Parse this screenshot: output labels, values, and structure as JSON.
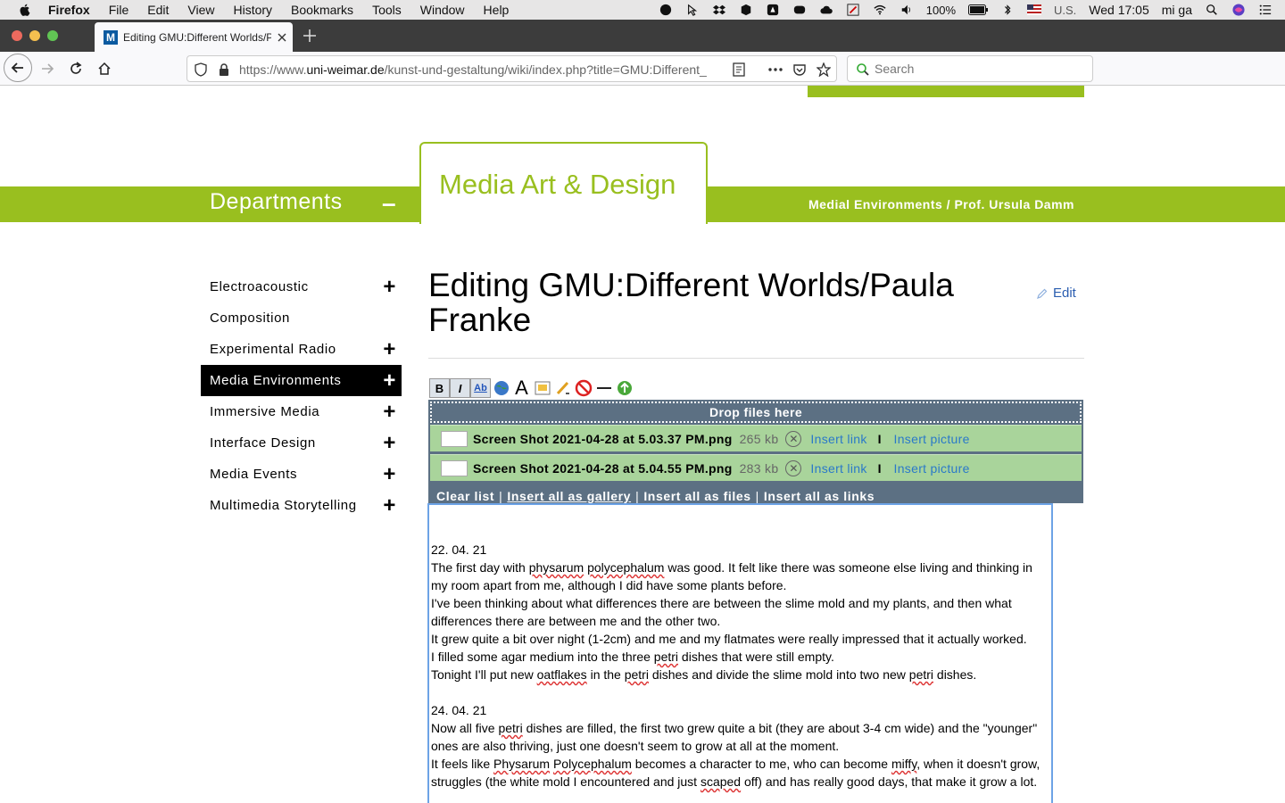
{
  "menubar": {
    "app": "Firefox",
    "items": [
      "File",
      "Edit",
      "View",
      "History",
      "Bookmarks",
      "Tools",
      "Window",
      "Help"
    ],
    "battery": "100%",
    "input_source": "U.S.",
    "clock": "Wed 17:05",
    "user": "mi ga"
  },
  "browser": {
    "tab_title": "Editing GMU:Different Worlds/P",
    "favicon_letter": "M",
    "url_prefix": "https://www.",
    "url_host": "uni-weimar.de",
    "url_path": "/kunst-und-gestaltung/wiki/index.php?title=GMU:Different_",
    "search_placeholder": "Search",
    "colors": {
      "tabstrip": "#3c3c3c",
      "toolbar": "#f9f9fb"
    }
  },
  "header": {
    "faculty": "Media Art & Design",
    "departments": "Departments",
    "collapse": "–",
    "chair": "Medial Environments / Prof. Ursula Damm",
    "accent": "#99bf1f"
  },
  "sidebar": {
    "items": [
      {
        "label": "Electroacoustic",
        "plus": "+"
      },
      {
        "label": "Composition",
        "plus": ""
      },
      {
        "label": "Experimental Radio",
        "plus": "+"
      },
      {
        "label": "Media Environments",
        "plus": "+"
      },
      {
        "label": "Immersive Media",
        "plus": "+"
      },
      {
        "label": "Interface Design",
        "plus": "+"
      },
      {
        "label": "Media Events",
        "plus": "+"
      },
      {
        "label": "Multimedia Storytelling",
        "plus": "+"
      }
    ]
  },
  "main": {
    "title": "Editing GMU:Different Worlds/Paula Franke",
    "edit_label": "Edit"
  },
  "toolbar": {
    "bold": "B",
    "italic": "I",
    "link": "Ab",
    "headline": "A"
  },
  "upload": {
    "drop_label": "Drop files here",
    "files": [
      {
        "name": "Screen Shot 2021-04-28 at 5.03.37 PM.png",
        "size": "265 kb",
        "insert_link": "Insert link",
        "sep": "I",
        "insert_picture": "Insert picture"
      },
      {
        "name": "Screen Shot 2021-04-28 at 5.04.55 PM.png",
        "size": "283 kb",
        "insert_link": "Insert link",
        "sep": "I",
        "insert_picture": "Insert picture"
      }
    ],
    "actions": {
      "clear": "Clear list",
      "gallery": "Insert all as gallery",
      "files": "Insert all as files",
      "links": "Insert all as links",
      "sep": "|"
    }
  },
  "editor": {
    "entry1": {
      "date": "22. 04. 21",
      "l1a": "The first day with ",
      "l1b": "physarum",
      "l1c": " ",
      "l1d": "polycephalum",
      "l1e": " was good. It felt like there was someone else living and thinking in my room apart from me, although I did have some plants before.",
      "l2": "I've been thinking about what differences there are between the slime mold and my plants, and then what differences there are between me and the other two.",
      "l3": "It grew quite a bit over night (1-2cm) and me and my flatmates were really impressed that it actually worked.",
      "l4a": "I filled some agar medium into the three ",
      "l4b": "petri",
      "l4c": " dishes that were still empty.",
      "l5a": "Tonight I'll put new ",
      "l5b": "oatflakes",
      "l5c": " in the ",
      "l5d": "petri",
      "l5e": " dishes and divide the slime mold into two new ",
      "l5f": "petri",
      "l5g": " dishes."
    },
    "entry2": {
      "date": "24. 04. 21",
      "l1a": "Now all five ",
      "l1b": "petri",
      "l1c": " dishes are filled, the first two grew quite a bit (they are about 3-4 cm wide) and the \"younger\" ones are also thriving, just one doesn't seem to grow at all at the moment.",
      "l2a": "It feels like ",
      "l2b": "Physarum",
      "l2c": " ",
      "l2d": "Polycephalum",
      "l2e": " becomes a character to me, who can become ",
      "l2f": "miffy",
      "l2g": ", when it doesn't grow, struggles (the white mold I encountered and just ",
      "l2h": "scaped",
      "l2i": " off) and has really good days, that make it grow a lot."
    }
  }
}
